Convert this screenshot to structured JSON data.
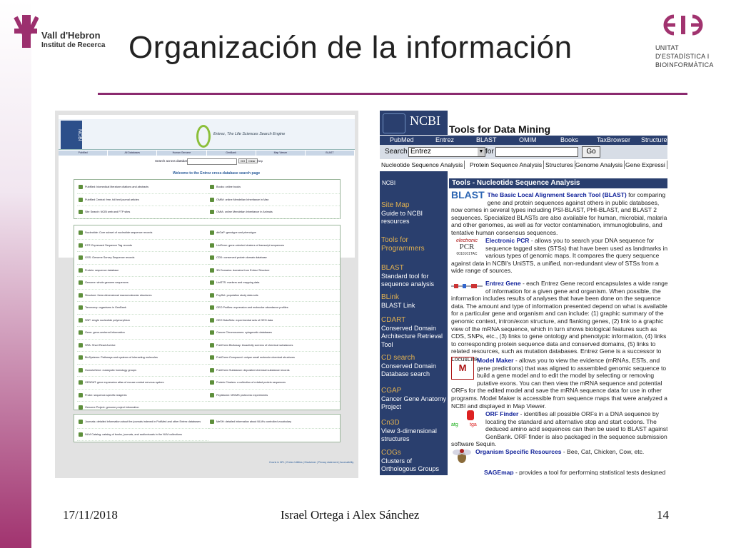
{
  "slide": {
    "title": "Organización de la información",
    "footer": {
      "date": "17/11/2018",
      "authors": "Israel Ortega i Alex Sánchez",
      "page": "14"
    }
  },
  "logos": {
    "vh_line1": "Vall d'Hebron",
    "vh_line2": "Institut de Recerca",
    "uei_line1": "UNITAT",
    "uei_line2": "D'ESTADÍSTICA I",
    "uei_line3": "BIOINFORMÀTICA"
  },
  "left_screenshot": {
    "logo": "NCBI",
    "subtitle": "Entrez, The Life Sciences Search Engine",
    "tabs": [
      "PubMed",
      "All Databases",
      "Human Genome",
      "GenBank",
      "Map Viewer",
      "BLAST"
    ],
    "search_label": "Search across databases",
    "go": "GO",
    "clear": "Clear",
    "help": "Help",
    "welcome": "Welcome to the Entrez cross-database search page",
    "panel_top": {
      "left": [
        "PubMed: biomedical literature citations and abstracts",
        "PubMed Central: free, full text journal articles",
        "Site Search: NCBI web and FTP sites"
      ],
      "right": [
        "Books: online books",
        "OMIM: online Mendelian Inheritance in Man",
        "OMIA: online Mendelian Inheritance in Animals"
      ]
    },
    "panel_mid": {
      "left": [
        "Nucleotide: Core subset of nucleotide sequence records",
        "EST: Expressed Sequence Tag records",
        "GSS: Genome Survey Sequence records",
        "Protein: sequence database",
        "Genome: whole genome sequences",
        "Structure: three-dimensional macromolecular structures",
        "Taxonomy: organisms in GenBank",
        "SNP: single nucleotide polymorphism",
        "Gene: gene-centered information",
        "SRA: Short Read Archive",
        "BioSystems: Pathways and systems of interacting molecules",
        "HomoloGene: eukaryotic homology groups",
        "GENSAT: gene expression atlas of mouse central nervous system",
        "Probe: sequence-specific reagents",
        "Genome Project: genome project information"
      ],
      "right": [
        "dbGaP: genotype and phenotype",
        "UniGene: gene-oriented clusters of transcript sequences",
        "CDD: conserved protein domain database",
        "3D Domains: domains from Entrez Structure",
        "UniSTS: markers and mapping data",
        "PopSet: population study data sets",
        "GEO Profiles: expression and molecular abundance profiles",
        "GEO DataSets: experimental sets of GEO data",
        "Cancer Chromosomes: cytogenetic databases",
        "PubChem BioAssay: bioactivity screens of chemical substances",
        "PubChem Compound: unique small molecule chemical structures",
        "PubChem Substance: deposited chemical substance records",
        "Protein Clusters: a collection of related protein sequences",
        "Peptidome: MS/MS proteomic experiments"
      ]
    },
    "panel_bottom": {
      "left": [
        "Journals: detailed information about the journals indexed in PubMed and other Entrez databases",
        "NLM Catalog: catalog of books, journals, and audiovisuals in the NLM collections"
      ],
      "right": [
        "MeSH: detailed information about NLM's controlled vocabulary"
      ]
    },
    "footer_links": "Courts in NFL | Entrez Utilities | Disclaimer | Privacy statement | Accessibility"
  },
  "right_screenshot": {
    "logo": "NCBI",
    "title": "Tools for Data Mining",
    "nav": [
      "PubMed",
      "Entrez",
      "BLAST",
      "OMIM",
      "Books",
      "TaxBrowser",
      "Structure"
    ],
    "search_label": "Search",
    "search_select": "Entrez",
    "for_label": "for",
    "go": "Go",
    "tabs": [
      "Nucleotide Sequence Analysis",
      "Protein Sequence Analysis",
      "Structures",
      "Genome Analysis",
      "Gene Expressi"
    ],
    "side_ncbi": "NCBI",
    "side": [
      {
        "head": "Site Map",
        "text": "Guide to NCBI resources"
      },
      {
        "head": "Tools for Programmers",
        "text": ""
      },
      {
        "head": "BLAST",
        "text": "Standard tool for sequence analysis"
      },
      {
        "head": "BLink",
        "text": "BLAST Link"
      },
      {
        "head": "CDART",
        "text": "Conserved Domain Architecture Retrieval Tool"
      },
      {
        "head": "CD search",
        "text": "Conserved Domain Database search"
      },
      {
        "head": "CGAP",
        "text": "Cancer Gene Anatomy Project"
      },
      {
        "head": "Cn3D",
        "text": "View 3-dimensional structures"
      },
      {
        "head": "COGs",
        "text": "Clusters of Orthologous Groups"
      }
    ],
    "section_head": "Tools - Nucleotide Sequence Analysis",
    "entries": [
      {
        "name": "The Basic Local Alignment Search Tool (BLAST)",
        "text": " for comparing gene and protein sequences against others in public databases, now comes in several types including PSI-BLAST, PHI-BLAST, and BLAST 2 sequences. Specialized BLASTs are also available for human, microbial, malaria, and other genomes, as well as for vector contamination, immunoglobulins, and tentative human consensus sequences."
      },
      {
        "name": "Electronic PCR",
        "text": " - allows you to search your DNA sequence for sequence tagged sites (STSs) that have been used as landmarks in various types of genomic maps. It compares the query sequence against data in NCBI's UniSTS, a unified, non-redundant view of STSs from a wide range of sources."
      },
      {
        "name": "Entrez Gene",
        "text": " - each Entrez Gene record encapsulates a wide range of information for a given gene and organism. When possible, the information includes results of analyses that have been done on the sequence data. The amount and type of information presented depend on what is available for a particular gene and organism and can include: (1) graphic summary of the genomic context, intron/exon structure, and flanking genes, (2) link to a graphic view of the mRNA sequence, which in turn shows biological features such as CDS, SNPs, etc., (3) links to gene ontology and phenotypic information, (4) links to corresponding protein sequence data and conserved domains, (5) links to related resources, such as mutation databases. Entrez Gene is a successor to LocusLink."
      },
      {
        "name": "Model Maker",
        "text": " - allows you to view the evidence (mRNAs, ESTs, and gene predictions) that was aligned to assembled genomic sequence to build a gene model and to edit the model by selecting or removing putative exons. You can then view the mRNA sequence and potential ORFs for the edited model and save the mRNA sequence data for use in other programs. Model Maker is accessible from sequence maps that were analyzed at NCBI and displayed in Map Viewer."
      },
      {
        "name": "ORF Finder",
        "text": " - identifies all possible ORFs in a DNA sequence by locating the standard and alternative stop and start codons. The deduced amino acid sequences can then be used to BLAST against GenBank. ORF finder is also packaged in the sequence submission software Sequin."
      },
      {
        "name": "Organism Specific Resources",
        "text": " - Bee, Cat, Chicken, Cow, etc."
      },
      {
        "name": "SAGEmap",
        "text": " - provides a tool for performing statistical tests designed"
      }
    ],
    "icon_labels": {
      "blast": "BLAST",
      "pcr_top": "electronic",
      "pcr_mid": "PCR",
      "pcr_bot": "0010101TAC",
      "orf": "atg",
      "orf2": "tga"
    }
  }
}
